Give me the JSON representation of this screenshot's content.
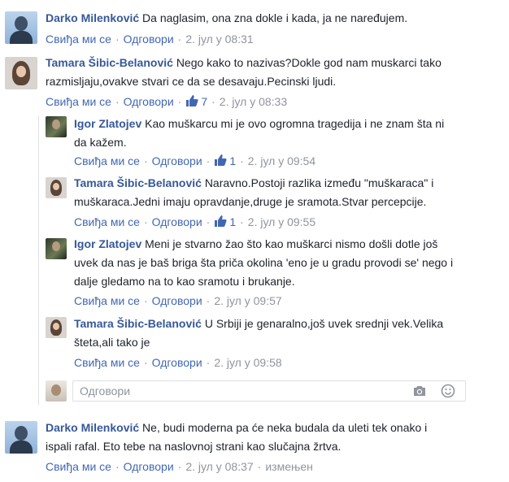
{
  "comments": [
    {
      "author": "Darko Milenković",
      "text": "Da naglasim, ona zna dokle i kada, ja ne naređujem.",
      "like": "Свиђа ми се",
      "reply": "Одговори",
      "time": "2. јул у 08:31"
    },
    {
      "author": "Tamara Šibic-Belanović",
      "text": "Nego kako to nazivas?Dokle god nam muskarci tako razmisljaju,ovakve stvari ce da se desavaju.Pecinski ljudi.",
      "like": "Свиђа ми се",
      "reply": "Одговори",
      "likes_count": "7",
      "time": "2. јул у 08:33",
      "replies": [
        {
          "author": "Igor Zlatojev",
          "text": "Kao muškarcu mi je ovo ogromna tragedija i ne znam šta ni da kažem.",
          "like": "Свиђа ми се",
          "reply": "Одговори",
          "likes_count": "1",
          "time": "2. јул у 09:54"
        },
        {
          "author": "Tamara Šibic-Belanović",
          "text": "Naravno.Postoji razlika između \"muškaraca\" i muškaraca.Jedni imaju opravdanje,druge je sramota.Stvar percepcije.",
          "like": "Свиђа ми се",
          "reply": "Одговори",
          "likes_count": "1",
          "time": "2. јул у 09:55"
        },
        {
          "author": "Igor Zlatojev",
          "text": "Meni je stvarno žao što kao muškarci nismo došli dotle još uvek da nas je baš briga šta priča okolina 'eno je u gradu provodi se' nego i dalje gledamo na to kao sramotu i brukanje.",
          "like": "Свиђа ми се",
          "reply": "Одговори",
          "time": "2. јул у 09:57"
        },
        {
          "author": "Tamara Šibic-Belanović",
          "text": "U Srbiji je genaralno,još uvek srednji vek.Velika šteta,ali tako je",
          "like": "Свиђа ми се",
          "reply": "Одговори",
          "time": "2. јул у 09:58"
        }
      ]
    },
    {
      "author": "Darko Milenković",
      "text": "Ne, budi moderna pa će neka budala da uleti tek onako i ispali rafal. Eto tebe na naslovnoj strani kao slučajna žrtva.",
      "like": "Свиђа ми се",
      "reply": "Одговори",
      "time": "2. јул у 08:37",
      "edited": "измењен"
    }
  ],
  "reply_input": {
    "placeholder": "Одговори",
    "camera_icon": "camera-icon",
    "emoji_icon": "emoji-icon"
  },
  "colors": {
    "name": "#365899",
    "link": "#4267b2",
    "meta": "#90949c",
    "border": "#dddfe2"
  }
}
